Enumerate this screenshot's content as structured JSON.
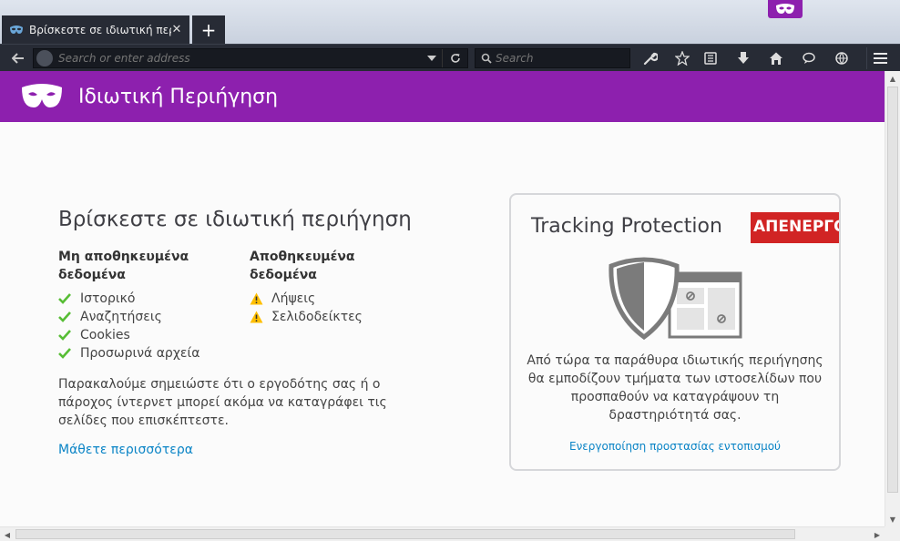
{
  "tab": {
    "title": "Βρίσκεστε σε ιδιωτική περι...",
    "close": "✕",
    "new_tab": "+"
  },
  "toolbar": {
    "url_placeholder": "Search or enter address",
    "search_placeholder": "Search"
  },
  "header": {
    "title": "Ιδιωτική Περιήγηση"
  },
  "main": {
    "title": "Βρίσκεστε σε ιδιωτική περιήγηση",
    "not_saved": {
      "heading": "Μη αποθηκευμένα δεδομένα",
      "items": [
        "Ιστορικό",
        "Αναζητήσεις",
        "Cookies",
        "Προσωρινά αρχεία"
      ]
    },
    "saved": {
      "heading": "Αποθηκευμένα δεδομένα",
      "items": [
        "Λήψεις",
        "Σελιδοδείκτες"
      ]
    },
    "notice": "Παρακαλούμε σημειώστε ότι ο εργοδότης σας ή ο πάροχος ίντερνετ μπορεί ακόμα να καταγράφει τις σελίδες που επισκέπτεστε.",
    "learn_more": "Μάθετε περισσότερα"
  },
  "tracking": {
    "title": "Tracking Protection",
    "status": "ΑΠΕΝΕΡΓΟΠΟΙ",
    "description": "Από τώρα τα παράθυρα ιδιωτικής περιήγησης θα εμποδίζουν τμήματα των ιστοσελίδων που προσπαθούν να καταγράψουν τη δραστηριότητά σας.",
    "link": "Ενεργοποίηση προστασίας εντοπισμού"
  },
  "colors": {
    "accent": "#8d20ae",
    "link": "#0a84c6",
    "badge": "#d12424",
    "check": "#57bd35",
    "warning": "#ffbf00"
  },
  "icons": [
    "mask-icon",
    "back-icon",
    "globe-icon",
    "dropdown-icon",
    "reload-icon",
    "search-icon",
    "wrench-icon",
    "star-icon",
    "reading-list-icon",
    "download-icon",
    "home-icon",
    "chat-icon",
    "globe-settings-icon",
    "hamburger-menu-icon",
    "check-icon",
    "warning-icon",
    "shield-icon"
  ]
}
